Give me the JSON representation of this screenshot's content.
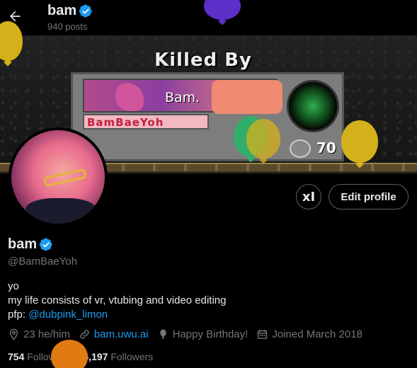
{
  "header": {
    "name": "bam",
    "posts": "940 posts"
  },
  "banner": {
    "title": "Killed By",
    "killer": "Bam.",
    "victim": "BamBaeYoh",
    "score": "70"
  },
  "actions": {
    "edit_profile": "Edit profile",
    "grok_label": "xI"
  },
  "profile": {
    "name": "bam",
    "handle": "@BamBaeYoh",
    "bio_line1": "yo",
    "bio_line2": "my life consists of vr, vtubing and video editing",
    "bio_pfp_prefix": "pfp: ",
    "bio_pfp_link": "@dubpink_limon",
    "location": "23 he/him",
    "website": "bam.uwu.ai",
    "birthday": "Happy Birthday!",
    "joined": "Joined March 2018",
    "following_count": "754",
    "following_label": "Following",
    "followers_count": "6,197",
    "followers_label": "Followers"
  },
  "colors": {
    "accent": "#1d9bf0",
    "muted": "#71767b",
    "text": "#e7e9ea",
    "background": "#000000",
    "border": "#536471"
  },
  "icons": [
    "back-arrow-icon",
    "verified-badge-icon",
    "location-icon",
    "link-icon",
    "balloon-icon",
    "calendar-icon"
  ]
}
